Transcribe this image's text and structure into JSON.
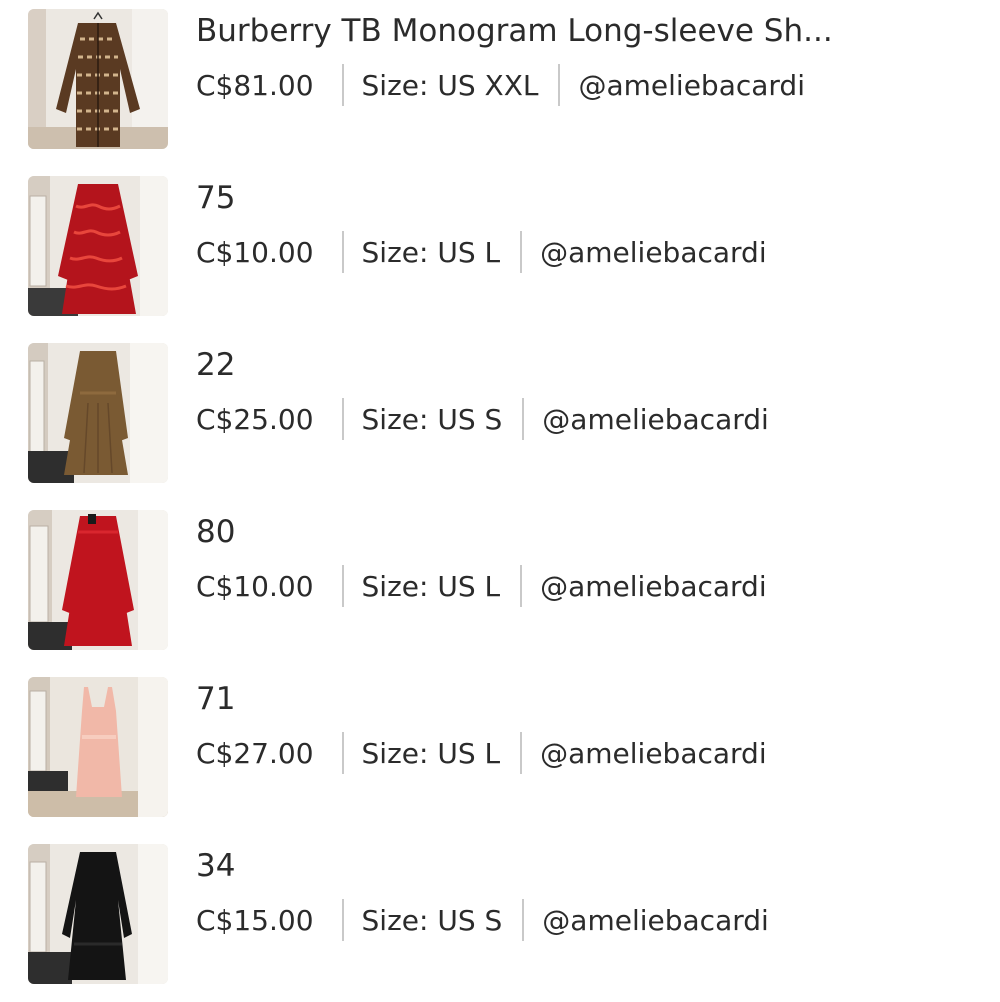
{
  "listings": [
    {
      "title": "Burberry TB Monogram Long-sleeve Sh...",
      "price": "C$81.00",
      "size": "Size: US XXL",
      "seller": "@ameliebacardi",
      "thumbnail": "brown patterned long-sleeve shirt on hanger",
      "garment_color": "#5a3a22",
      "accent_color": "#d2b48c"
    },
    {
      "title": "75",
      "price": "C$10.00",
      "size": "Size: US L",
      "seller": "@ameliebacardi",
      "thumbnail": "red printed dress on hanger",
      "garment_color": "#b4141c",
      "accent_color": "#e8463c"
    },
    {
      "title": "22",
      "price": "C$25.00",
      "size": "Size: US S",
      "seller": "@ameliebacardi",
      "thumbnail": "brown long-sleeve dress on hanger",
      "garment_color": "#7a5a33",
      "accent_color": "#8e6a3e"
    },
    {
      "title": "80",
      "price": "C$10.00",
      "size": "Size: US L",
      "seller": "@ameliebacardi",
      "thumbnail": "red long-sleeve dress on hanger",
      "garment_color": "#c0141e",
      "accent_color": "#d9262e"
    },
    {
      "title": "71",
      "price": "C$27.00",
      "size": "Size: US L",
      "seller": "@ameliebacardi",
      "thumbnail": "pink slip dress on hanger",
      "garment_color": "#f1b8a8",
      "accent_color": "#f7cdbf"
    },
    {
      "title": "34",
      "price": "C$15.00",
      "size": "Size: US S",
      "seller": "@ameliebacardi",
      "thumbnail": "black long dress on hanger",
      "garment_color": "#141414",
      "accent_color": "#2a2a2a"
    }
  ]
}
